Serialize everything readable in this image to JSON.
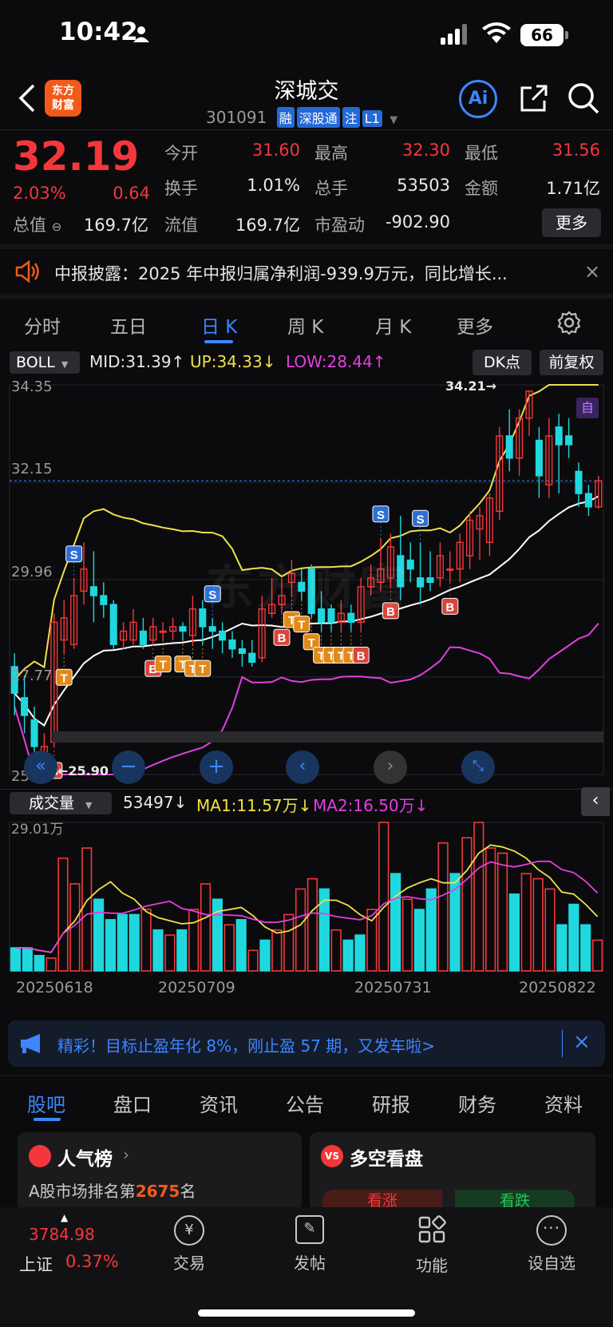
{
  "status_bar": {
    "time": "10:42",
    "battery": "66"
  },
  "header": {
    "title": "深城交",
    "code": "301091",
    "tags": [
      "融",
      "深股通",
      "注",
      "L1"
    ],
    "logo": "东方财富"
  },
  "quote": {
    "price": "32.19",
    "change_pct": "2.03%",
    "change": "0.64",
    "fields": [
      {
        "label": "今开",
        "value": "31.60",
        "color": "#f5373b"
      },
      {
        "label": "最高",
        "value": "32.30",
        "color": "#f5373b"
      },
      {
        "label": "最低",
        "value": "31.56",
        "color": "#f5373b"
      },
      {
        "label": "换手",
        "value": "1.01%",
        "color": "#e9e9e9"
      },
      {
        "label": "总手",
        "value": "53503",
        "color": "#e9e9e9"
      },
      {
        "label": "金额",
        "value": "1.71亿",
        "color": "#e9e9e9"
      },
      {
        "label": "总值",
        "value": "169.7亿",
        "color": "#e9e9e9"
      },
      {
        "label": "流值",
        "value": "169.7亿",
        "color": "#e9e9e9"
      },
      {
        "label": "市盈动",
        "value": "-902.90",
        "color": "#e9e9e9"
      }
    ],
    "more_label": "更多"
  },
  "notice": {
    "text": "中报披露：2025 年中报归属净利润-939.9万元，同比增长..."
  },
  "chart_tabs": [
    "分时",
    "五日",
    "日 K",
    "周 K",
    "月 K",
    "更多"
  ],
  "active_tab": 2,
  "boll_bar": {
    "indicator": "BOLL",
    "mid": "MID:31.39↑",
    "up": "UP:34.33↓",
    "low": "LOW:28.44↑",
    "dk_button": "DK点",
    "adjust_button": "前复权"
  },
  "price_axis": [
    "34.35",
    "32.15",
    "29.96",
    "27.77",
    "25.57"
  ],
  "annotations": {
    "high": "34.21→",
    "low": "←25.90",
    "self_mark": "自"
  },
  "volume_bar": {
    "indicator": "成交量",
    "value": "53497↓",
    "ma1": "MA1:11.57万↓",
    "ma2": "MA2:16.50万↓",
    "axis_top": "29.01万"
  },
  "dates": [
    "20250618",
    "20250709",
    "20250731",
    "20250822"
  ],
  "watermark": "东方财富",
  "banner": {
    "text": "精彩！目标止盈年化 8%，刚止盈 57 期，又发车啦>"
  },
  "bottom_tabs": [
    "股吧",
    "盘口",
    "资讯",
    "公告",
    "研报",
    "财务",
    "资料"
  ],
  "cards": {
    "popularity_title": "人气榜",
    "popularity_rank_prefix": "A股市场排名第",
    "popularity_rank": "2675",
    "popularity_rank_suffix": "名",
    "bull_bear_title": "多空看盘",
    "bull_label": "看涨",
    "bear_label": "看跌"
  },
  "navbar": {
    "index_value": "3784.98",
    "index_name": "上证",
    "index_change": "0.37%",
    "items": [
      "交易",
      "发帖",
      "功能",
      "设自选"
    ]
  },
  "colors": {
    "up": "#f5373b",
    "down": "#1fd8de",
    "mid": "#ffffff",
    "upper": "#f0e14a",
    "lower": "#e23fe0",
    "accent": "#3d86ff"
  },
  "chart_data": {
    "type": "candlestick",
    "indicator": "BOLL",
    "ylim": [
      25.57,
      34.35
    ],
    "candles": [
      {
        "o": 28.0,
        "c": 27.4,
        "h": 28.3,
        "l": 26.9
      },
      {
        "o": 27.3,
        "c": 26.9,
        "h": 27.8,
        "l": 26.5
      },
      {
        "o": 26.8,
        "c": 26.2,
        "h": 27.1,
        "l": 25.9
      },
      {
        "o": 26.0,
        "c": 26.2,
        "h": 26.5,
        "l": 25.9
      },
      {
        "o": 26.3,
        "c": 29.0,
        "h": 29.2,
        "l": 26.2
      },
      {
        "o": 28.6,
        "c": 29.1,
        "h": 29.5,
        "l": 28.3
      },
      {
        "o": 28.5,
        "c": 29.6,
        "h": 30.0,
        "l": 28.4
      },
      {
        "o": 29.7,
        "c": 30.2,
        "h": 30.8,
        "l": 29.4
      },
      {
        "o": 29.8,
        "c": 29.6,
        "h": 30.6,
        "l": 29.0
      },
      {
        "o": 29.6,
        "c": 29.4,
        "h": 29.9,
        "l": 29.1
      },
      {
        "o": 29.4,
        "c": 28.5,
        "h": 29.5,
        "l": 28.4
      },
      {
        "o": 28.6,
        "c": 28.8,
        "h": 29.0,
        "l": 28.4
      },
      {
        "o": 28.6,
        "c": 29.0,
        "h": 29.3,
        "l": 28.5
      },
      {
        "o": 28.8,
        "c": 28.5,
        "h": 29.1,
        "l": 28.4
      },
      {
        "o": 28.6,
        "c": 28.9,
        "h": 29.1,
        "l": 28.5
      },
      {
        "o": 28.8,
        "c": 28.8,
        "h": 29.0,
        "l": 28.6
      },
      {
        "o": 28.8,
        "c": 28.9,
        "h": 29.1,
        "l": 28.6
      },
      {
        "o": 28.9,
        "c": 28.8,
        "h": 29.0,
        "l": 28.6
      },
      {
        "o": 28.7,
        "c": 29.3,
        "h": 29.6,
        "l": 28.5
      },
      {
        "o": 29.3,
        "c": 28.9,
        "h": 29.5,
        "l": 28.5
      },
      {
        "o": 28.9,
        "c": 28.8,
        "h": 29.1,
        "l": 28.4
      },
      {
        "o": 28.8,
        "c": 28.6,
        "h": 29.0,
        "l": 28.3
      },
      {
        "o": 28.6,
        "c": 28.4,
        "h": 28.8,
        "l": 28.2
      },
      {
        "o": 28.4,
        "c": 28.3,
        "h": 28.6,
        "l": 28.0
      },
      {
        "o": 28.3,
        "c": 28.1,
        "h": 28.6,
        "l": 28.0
      },
      {
        "o": 28.2,
        "c": 29.3,
        "h": 29.6,
        "l": 28.1
      },
      {
        "o": 29.2,
        "c": 29.4,
        "h": 30.0,
        "l": 29.1
      },
      {
        "o": 29.4,
        "c": 29.6,
        "h": 30.0,
        "l": 29.2
      },
      {
        "o": 29.9,
        "c": 30.1,
        "h": 30.4,
        "l": 29.6
      },
      {
        "o": 29.9,
        "c": 29.7,
        "h": 30.2,
        "l": 29.5
      },
      {
        "o": 30.2,
        "c": 29.2,
        "h": 30.3,
        "l": 29.1
      },
      {
        "o": 29.3,
        "c": 29.0,
        "h": 29.7,
        "l": 28.8
      },
      {
        "o": 29.3,
        "c": 29.0,
        "h": 29.4,
        "l": 28.8
      },
      {
        "o": 29.0,
        "c": 29.2,
        "h": 29.5,
        "l": 28.8
      },
      {
        "o": 29.2,
        "c": 29.0,
        "h": 29.4,
        "l": 28.8
      },
      {
        "o": 29.0,
        "c": 29.8,
        "h": 30.0,
        "l": 28.8
      },
      {
        "o": 29.8,
        "c": 30.0,
        "h": 30.3,
        "l": 29.6
      },
      {
        "o": 29.9,
        "c": 30.2,
        "h": 30.9,
        "l": 29.7
      },
      {
        "o": 30.0,
        "c": 30.7,
        "h": 31.0,
        "l": 29.8
      },
      {
        "o": 30.5,
        "c": 29.8,
        "h": 31.4,
        "l": 29.5
      },
      {
        "o": 30.4,
        "c": 30.2,
        "h": 30.8,
        "l": 29.9
      },
      {
        "o": 30.0,
        "c": 29.8,
        "h": 30.8,
        "l": 29.4
      },
      {
        "o": 30.0,
        "c": 29.9,
        "h": 30.6,
        "l": 29.7
      },
      {
        "o": 30.0,
        "c": 30.5,
        "h": 30.8,
        "l": 29.8
      },
      {
        "o": 30.2,
        "c": 30.2,
        "h": 30.6,
        "l": 29.9
      },
      {
        "o": 30.2,
        "c": 30.8,
        "h": 31.0,
        "l": 29.9
      },
      {
        "o": 30.5,
        "c": 31.3,
        "h": 31.5,
        "l": 30.2
      },
      {
        "o": 31.1,
        "c": 31.4,
        "h": 31.6,
        "l": 30.4
      },
      {
        "o": 30.8,
        "c": 31.8,
        "h": 31.9,
        "l": 30.5
      },
      {
        "o": 31.5,
        "c": 33.2,
        "h": 33.4,
        "l": 31.3
      },
      {
        "o": 33.2,
        "c": 32.7,
        "h": 33.8,
        "l": 32.4
      },
      {
        "o": 32.7,
        "c": 33.6,
        "h": 33.8,
        "l": 32.3
      },
      {
        "o": 33.6,
        "c": 34.21,
        "h": 34.21,
        "l": 33.2
      },
      {
        "o": 33.1,
        "c": 32.3,
        "h": 33.4,
        "l": 31.8
      },
      {
        "o": 32.1,
        "c": 33.2,
        "h": 33.6,
        "l": 31.8
      },
      {
        "o": 33.4,
        "c": 33.0,
        "h": 33.7,
        "l": 31.9
      },
      {
        "o": 33.2,
        "c": 33.0,
        "h": 33.6,
        "l": 32.7
      },
      {
        "o": 32.4,
        "c": 31.9,
        "h": 32.6,
        "l": 31.6
      },
      {
        "o": 31.9,
        "c": 31.6,
        "h": 32.1,
        "l": 31.4
      },
      {
        "o": 31.6,
        "c": 32.19,
        "h": 32.3,
        "l": 31.56
      }
    ],
    "signals": [
      {
        "i": 4,
        "t": "B"
      },
      {
        "i": 5,
        "t": "T"
      },
      {
        "i": 6,
        "t": "S"
      },
      {
        "i": 14,
        "t": "B"
      },
      {
        "i": 15,
        "t": "T"
      },
      {
        "i": 17,
        "t": "T"
      },
      {
        "i": 18,
        "t": "T"
      },
      {
        "i": 19,
        "t": "T"
      },
      {
        "i": 20,
        "t": "S"
      },
      {
        "i": 27,
        "t": "B"
      },
      {
        "i": 28,
        "t": "T"
      },
      {
        "i": 29,
        "t": "T"
      },
      {
        "i": 30,
        "t": "T"
      },
      {
        "i": 31,
        "t": "T"
      },
      {
        "i": 32,
        "t": "T"
      },
      {
        "i": 33,
        "t": "T"
      },
      {
        "i": 34,
        "t": "T"
      },
      {
        "i": 35,
        "t": "B"
      },
      {
        "i": 37,
        "t": "S"
      },
      {
        "i": 38,
        "t": "B"
      },
      {
        "i": 41,
        "t": "S"
      },
      {
        "i": 44,
        "t": "B"
      }
    ],
    "volume": [
      {
        "v": 4.5,
        "up": false
      },
      {
        "v": 4.5,
        "up": false
      },
      {
        "v": 3.0,
        "up": false
      },
      {
        "v": 2.5,
        "up": true
      },
      {
        "v": 22.0,
        "up": true
      },
      {
        "v": 17.0,
        "up": true
      },
      {
        "v": 24.0,
        "up": true
      },
      {
        "v": 14.0,
        "up": false
      },
      {
        "v": 10.0,
        "up": false
      },
      {
        "v": 11.0,
        "up": false
      },
      {
        "v": 11.0,
        "up": false
      },
      {
        "v": 12.0,
        "up": true
      },
      {
        "v": 8.0,
        "up": false
      },
      {
        "v": 7.0,
        "up": true
      },
      {
        "v": 8.0,
        "up": false
      },
      {
        "v": 12.0,
        "up": true
      },
      {
        "v": 17.0,
        "up": true
      },
      {
        "v": 14.0,
        "up": false
      },
      {
        "v": 9.0,
        "up": true
      },
      {
        "v": 10.0,
        "up": false
      },
      {
        "v": 4.0,
        "up": true
      },
      {
        "v": 6.0,
        "up": false
      },
      {
        "v": 8.0,
        "up": true
      },
      {
        "v": 11.0,
        "up": true
      },
      {
        "v": 16.0,
        "up": true
      },
      {
        "v": 18.0,
        "up": true
      },
      {
        "v": 16.0,
        "up": false
      },
      {
        "v": 8.0,
        "up": true
      },
      {
        "v": 6.0,
        "up": false
      },
      {
        "v": 7.0,
        "up": false
      },
      {
        "v": 12.0,
        "up": true
      },
      {
        "v": 29.01,
        "up": true
      },
      {
        "v": 19.0,
        "up": false
      },
      {
        "v": 14.0,
        "up": true
      },
      {
        "v": 12.0,
        "up": false
      },
      {
        "v": 16.0,
        "up": false
      },
      {
        "v": 25.0,
        "up": true
      },
      {
        "v": 19.0,
        "up": false
      },
      {
        "v": 26.0,
        "up": true
      },
      {
        "v": 29.0,
        "up": true
      },
      {
        "v": 24.0,
        "up": true
      },
      {
        "v": 23.0,
        "up": true
      },
      {
        "v": 15.0,
        "up": false
      },
      {
        "v": 19.0,
        "up": true
      },
      {
        "v": 18.0,
        "up": true
      },
      {
        "v": 16.0,
        "up": true
      },
      {
        "v": 9.0,
        "up": false
      },
      {
        "v": 13.0,
        "up": false
      },
      {
        "v": 9.0,
        "up": false
      },
      {
        "v": 6.0,
        "up": true
      }
    ]
  }
}
